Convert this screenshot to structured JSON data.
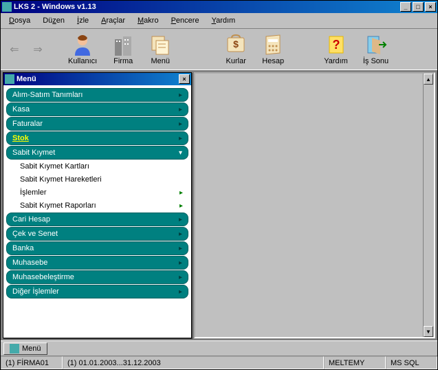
{
  "window": {
    "title": "LKS 2 - Windows v1.13"
  },
  "menubar": {
    "items": [
      "Dosya",
      "Düzen",
      "İzle",
      "Araçlar",
      "Makro",
      "Pencere",
      "Yardım"
    ]
  },
  "toolbar": {
    "kullanici": "Kullanıcı",
    "firma": "Firma",
    "menu": "Menü",
    "kurlar": "Kurlar",
    "hesap": "Hesap",
    "yardim": "Yardım",
    "is_sonu": "İş Sonu"
  },
  "inner": {
    "title": "Menü"
  },
  "menu": {
    "items": [
      {
        "label": "Alım-Satım Tanımları"
      },
      {
        "label": "Kasa"
      },
      {
        "label": "Faturalar"
      },
      {
        "label": "Stok"
      },
      {
        "label": "Sabit Kıymet"
      },
      {
        "label": "Cari Hesap"
      },
      {
        "label": "Çek ve Senet"
      },
      {
        "label": "Banka"
      },
      {
        "label": "Muhasebe"
      },
      {
        "label": "Muhasebeleştirme"
      },
      {
        "label": "Diğer İşlemler"
      }
    ],
    "sub": [
      {
        "label": "Sabit Kıymet Kartları",
        "has_sub": false
      },
      {
        "label": "Sabit Kıymet Hareketleri",
        "has_sub": false
      },
      {
        "label": "İşlemler",
        "has_sub": true
      },
      {
        "label": "Sabit Kıymet Raporları",
        "has_sub": true
      }
    ]
  },
  "taskbar": {
    "item": "Menü"
  },
  "status": {
    "firma": "(1) FİRMA01",
    "period": "(1) 01.01.2003...31.12.2003",
    "user": "MELTEMY",
    "db": "MS SQL"
  }
}
